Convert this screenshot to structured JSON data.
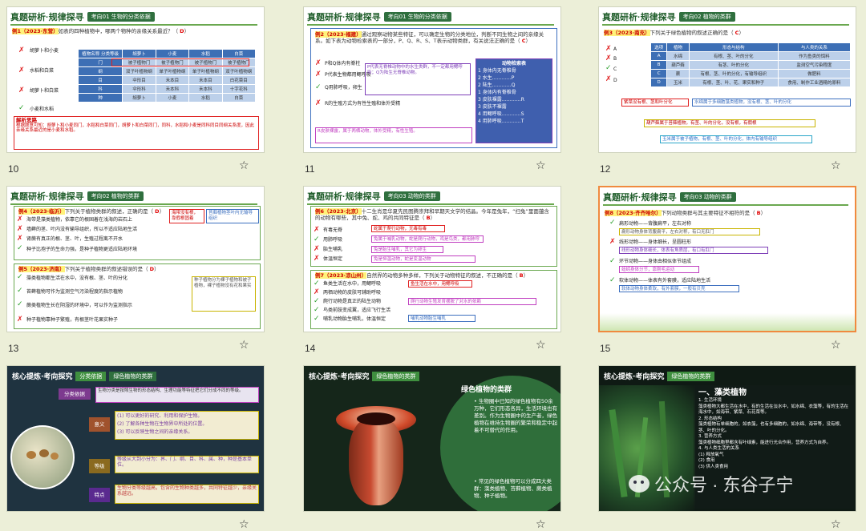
{
  "slides": [
    {
      "num": "10",
      "header_title": "真题研析·规律探寻",
      "header_tag": "考向01 生物的分类依据",
      "question_prefix": "例1（2023·东营）",
      "question": "如表的四种植物中，哪两个物种的亲缘关系最近？（",
      "answer": "D",
      "options": [
        "胡萝卜和小麦",
        "水稻和白菜",
        "胡萝卜和白菜",
        "小麦和水稻"
      ],
      "option_marks": [
        "x",
        "x",
        "x",
        "ok"
      ],
      "table_headers": [
        "植物名称\n分类等级",
        "胡萝卜",
        "小麦",
        "水稻",
        "白菜"
      ],
      "table_rows": [
        [
          "门",
          "被子植物门",
          "被子植物门",
          "被子植物门",
          "被子植物门"
        ],
        [
          "纲",
          "双子叶植物纲",
          "单子叶植物纲",
          "单子叶植物纲",
          "双子叶植物纲"
        ],
        [
          "目",
          "伞形目",
          "禾本目",
          "禾本目",
          "白花菜目"
        ],
        [
          "科",
          "伞形科",
          "禾本科",
          "禾本科",
          "十字花科"
        ],
        [
          "种",
          "胡萝卜",
          "小麦",
          "水稻",
          "白菜"
        ]
      ],
      "analysis_title": "解析思路",
      "analysis": "根据题意可知：胡萝卜和小麦同门，水稻和白菜同门，胡萝卜和白菜同门，同科，水稻和小麦是同科同目同纲关系度，因此亲缘关系最近的是小麦和水稻。"
    },
    {
      "num": "11",
      "header_title": "真题研析·规律探寻",
      "header_tag": "考向01 生物的分类依据",
      "question_prefix": "例2（2023·福建）",
      "question": "通过观察动物某些特征，可以确定生物的分类地位，判断不同生物之间的亲缘关系。如下表为动物检索表的一部分，P、Q、R、S、T表示动物类群，有关说法正确的是（",
      "answer": "C",
      "key_title": "动物检索表",
      "key_lines": [
        "1 身体内无脊椎骨",
        "2 水生…………P",
        "2 陆生…………Q",
        "1 身体内有脊椎骨",
        "3 皮肤裸露…………R",
        "3 皮肤不裸露",
        "4 用鳃呼吸…………S",
        "4 用肺呼吸…………T"
      ],
      "options": [
        "P和Q体内有脊柱",
        "P代表生物都用鳃呼吸",
        "Q用肺呼吸，卵生",
        "R的生殖方式为有性生殖和体外受精"
      ],
      "option_marks": [
        "x",
        "x",
        "ok",
        "x"
      ]
    },
    {
      "num": "12",
      "header_title": "真题研析·规律探寻",
      "header_tag": "考向02 植物的类群",
      "question_prefix": "例3（2023·南充）",
      "question": "下列关于绿色植物的叙述正确的是（",
      "answer": "C",
      "table_headers": [
        "选项",
        "植物",
        "形态与结构",
        "与人类的关系"
      ],
      "table_rows": [
        [
          "A",
          "水绵",
          "有根、茎、叶的分化",
          "作为鱼类的饵料"
        ],
        [
          "B",
          "葫芦藓",
          "有茎、叶的分化",
          "监测空气污染程度"
        ],
        [
          "C",
          "蕨",
          "有根、茎、叶的分化，有输导组织",
          "做肥料"
        ],
        [
          "D",
          "玉米",
          "有根、茎、叶、花、果实和种子",
          "食用、制作工业酒精的原料"
        ]
      ],
      "notes": [
        "紫菜没有根、茎和叶分化",
        "水绵属于多细胞藻类植物，没有根、茎、叶的分化",
        "葫芦藓属于苔藓植物，有茎、叶的分化，没有根，有假根",
        "玉米属于被子植物，有根、茎、叶的分化，体内有输导组织"
      ]
    },
    {
      "num": "13",
      "header_title": "真题研析·规律探寻",
      "header_tag": "考向02 植物的类群",
      "q1_prefix": "例4（2023·临沂）",
      "q1": "下列关于植物类群的叙述，正确的是（",
      "q1_answer": "D",
      "q1_options": [
        "海带是藻类植物，依靠它的根固着在浅海的岩石上",
        "墙藓的茎、叶内没有输导组织，所以不适应陆地生活",
        "肾蕨有真正的根、茎、叶，生殖过程离不开水",
        "种子比孢子的生命力强，是种子植物更适应陆地环境"
      ],
      "q1_marks": [
        "x",
        "x",
        "x",
        "ok"
      ],
      "q2_prefix": "例5（2023·济南）",
      "q2": "下列关于植物类群的叙述错误的是（",
      "q2_answer": "D",
      "q2_options": [
        "藻类植物都生活在水中，没有根、茎、叶的分化",
        "苔藓植物可作为监测空气污染程度的指示植物",
        "蕨类植物生长在阴湿的环境中，可以作为监测指示",
        "种子植物靠种子繁殖，有根茎叶花果实种子"
      ],
      "q2_marks": [
        "ok",
        "ok",
        "ok",
        "x"
      ]
    },
    {
      "num": "14",
      "header_title": "真题研析·规律探寻",
      "header_tag": "考向03 动物的类群",
      "q1_prefix": "例6（2023·北京）",
      "q1": "十二生肖是华夏先民图腾崇拜和早期天文学的结晶。今年是兔年，“扫兔”里面蕴含的动物有哪些，其中兔、蛇、鸡的共同特征是（",
      "q1_answer": "B",
      "q1_options": [
        "有毒无脊",
        "用肺呼吸",
        "胎生哺乳",
        "体温恒定"
      ],
      "q1_marks": [
        "x",
        "ok",
        "x",
        "x"
      ],
      "q2_prefix": "例7（2023·凉山州）",
      "q2": "自然界的动物多种多样，下列关于动物特征的叙述，不正确的是（",
      "q2_answer": "B",
      "q2_options": [
        "鱼类生活在水中，用鳃呼吸",
        "两栖动物的皮肤可辅助呼吸",
        "爬行动物是真正的陆生动物",
        "鸟类前肢变成翼，适应飞行生活",
        "哺乳动物胎生哺乳，体温恒定"
      ],
      "q2_marks": [
        "ok",
        "x",
        "ok",
        "ok",
        "ok"
      ]
    },
    {
      "num": "15",
      "header_title": "真题研析·规律探寻",
      "header_tag": "考向03 动物的类群",
      "question_prefix": "例8（2023·齐齐哈尔）",
      "question": "下列动物类群与其主要特征不相符的是（",
      "answer": "B",
      "options": [
        "扁形动物——背腹扁平，左右对称",
        "线形动物——身体细长，呈圆柱形",
        "环节动物——身体由相似体节组成",
        "软体动物——体表有外套膜，适应陆地生活"
      ],
      "option_marks": [
        "ok",
        "x",
        "ok",
        "ok"
      ]
    },
    {
      "header_title": "核心提炼·考向探究",
      "header_tag": "分类依据",
      "header_tag2": "绿色植物的类群",
      "left_label": "分类依据",
      "top_text": "生物分类是按照生物的形态结构、生理功能等特征把它们分成不同的等级。",
      "rows": [
        {
          "label": "意义",
          "text": "(1) 可以更好的研究、利用和保护生物。\n(2) 了解各种生物在生物界中所处的位置。\n(3) 可以反映生物之间的亲缘关系。"
        },
        {
          "label": "等级",
          "text": "等级从大到小分为：界、门、纲、目、科、属、种，种是基本单位。"
        },
        {
          "label": "特点",
          "text": "生物分类等级越高，包含的生物种类越多，共同特征越少，亲缘关系越远。"
        }
      ]
    },
    {
      "header_title": "核心提炼·考向探究",
      "header_tag": "绿色植物的类群",
      "panel_title": "绿色植物的类群",
      "bullets": [
        "生物圈中已知的绿色植物有50余万种，它们形态各异，生活环境也有差别。作为生物圈中的生产者，绿色植物在维持生物圈的繁荣和稳定中起着不可替代的作用。",
        "常见的绿色植物可以分成四大类群：藻类植物、苔藓植物、蕨类植物、种子植物。"
      ]
    },
    {
      "header_title": "核心提炼·考向探究",
      "header_tag": "绿色植物的类群",
      "section_title": "一、藻类植物",
      "items": [
        "1. 生活环境",
        "藻类植物大都生活在水中，有的生活在淡水中，如水绵、衣藻等，有的生活在海水中，如海带、紫菜、石花菜等。",
        "2. 形态结构",
        "藻类植物有单细胞的，如衣藻，也有多细胞的，如水绵、海带等，没有根、茎、叶的分化。",
        "3. 营养方式",
        "藻类植物细胞里都含有叶绿素，能进行光合作用，营养方式为自养。",
        "4. 与人类生活的关系",
        "(1) 释放氧气",
        "(2) 食用",
        "(3) 供人类食用",
        "(4) 工业和医药用"
      ],
      "watermark": "公众号 · 东谷子宁"
    }
  ],
  "colors": {
    "accent_green": "#1f5d2a",
    "selection_orange": "#f08a3e",
    "wrong_red": "#e02020",
    "right_green": "#2ca02c"
  }
}
